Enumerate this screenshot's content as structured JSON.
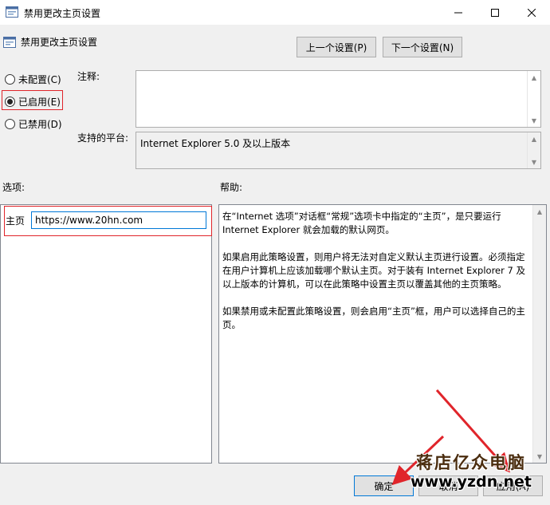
{
  "window": {
    "title": "禁用更改主页设置",
    "icon": "policy-icon",
    "controls": {
      "minimize": "minimize-icon",
      "maximize": "maximize-icon",
      "close": "close-icon"
    }
  },
  "header": {
    "title": "禁用更改主页设置",
    "prev_label": "上一个设置(P)",
    "next_label": "下一个设置(N)"
  },
  "state": {
    "options": [
      {
        "label": "未配置(C)",
        "selected": false
      },
      {
        "label": "已启用(E)",
        "selected": true
      },
      {
        "label": "已禁用(D)",
        "selected": false
      }
    ]
  },
  "comment": {
    "label": "注释:",
    "value": ""
  },
  "platform": {
    "label": "支持的平台:",
    "value": "Internet Explorer 5.0 及以上版本"
  },
  "options_panel": {
    "label": "选项:",
    "home_label": "主页",
    "home_value": "https://www.20hn.com"
  },
  "help_panel": {
    "label": "帮助:",
    "paragraphs": [
      "在“Internet 选项”对话框“常规”选项卡中指定的“主页”，是只要运行 Internet Explorer 就会加载的默认网页。",
      "如果启用此策略设置，则用户将无法对自定义默认主页进行设置。必须指定在用户计算机上应该加载哪个默认主页。对于装有 Internet Explorer 7 及以上版本的计算机，可以在此策略中设置主页以覆盖其他的主页策略。",
      "如果禁用或未配置此策略设置，则会启用“主页”框，用户可以选择自己的主页。"
    ]
  },
  "footer": {
    "ok_label": "确定",
    "cancel_label": "取消",
    "apply_label": "应用(A)"
  },
  "watermark": {
    "line1": "蒋店亿众电脑",
    "line2": "www.yzdn.net"
  },
  "colors": {
    "highlight_box": "#e0252b",
    "accent": "#0078d7",
    "arrow": "#e0252b"
  }
}
